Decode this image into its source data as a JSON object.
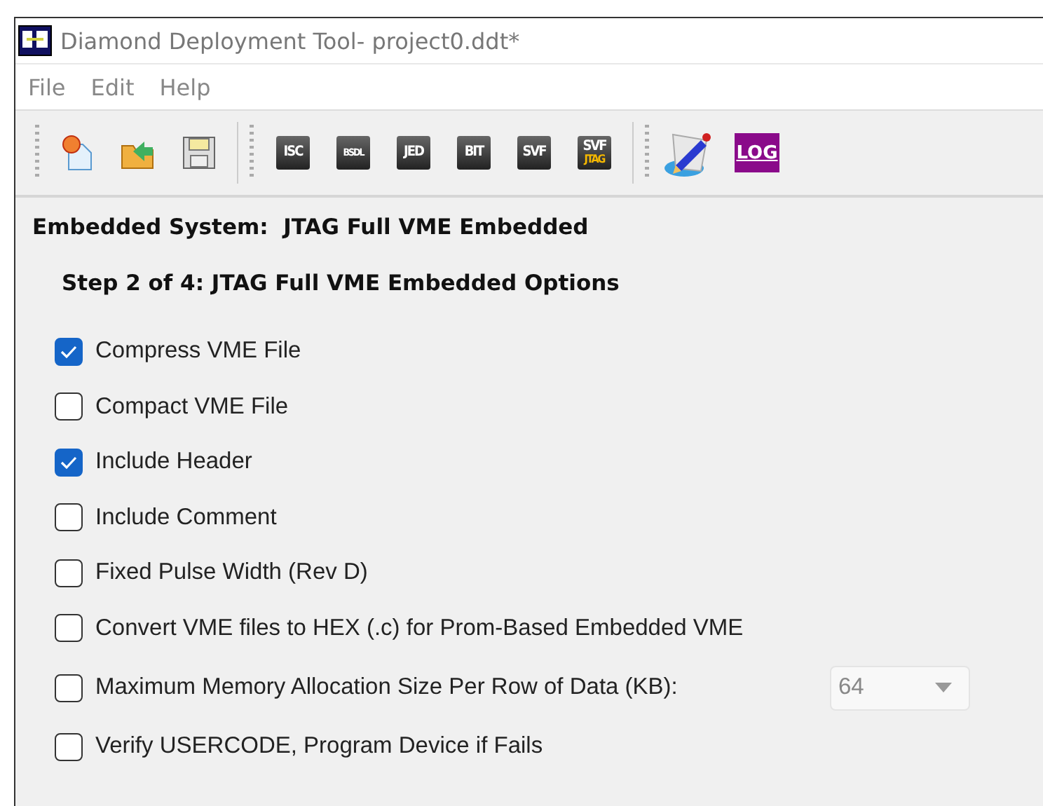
{
  "window": {
    "title": "Diamond Deployment Tool- project0.ddt*"
  },
  "menu": [
    "File",
    "Edit",
    "Help"
  ],
  "toolbar": [
    {
      "kind": "new"
    },
    {
      "kind": "open"
    },
    {
      "kind": "save"
    },
    {
      "kind": "sep"
    },
    {
      "kind": "chip",
      "label": "ISC"
    },
    {
      "kind": "chip",
      "label": "BSDL"
    },
    {
      "kind": "chip",
      "label": "JED"
    },
    {
      "kind": "chip",
      "label": "BIT"
    },
    {
      "kind": "chip",
      "label": "SVF"
    },
    {
      "kind": "chip",
      "label": "SVF",
      "sub": "JTAG"
    },
    {
      "kind": "sep"
    },
    {
      "kind": "edit"
    },
    {
      "kind": "log",
      "label": "LOG"
    }
  ],
  "heading": "Embedded System:  JTAG Full VME Embedded",
  "step": "Step 2 of 4: JTAG Full VME Embedded Options",
  "options": [
    {
      "label": "Compress VME File",
      "checked": true
    },
    {
      "label": "Compact VME File",
      "checked": false
    },
    {
      "label": "Include Header",
      "checked": true
    },
    {
      "label": "Include Comment",
      "checked": false
    },
    {
      "label": "Fixed Pulse Width (Rev D)",
      "checked": false
    },
    {
      "label": "Convert VME files to HEX (.c) for Prom-Based Embedded VME",
      "checked": false
    },
    {
      "label": "Maximum Memory Allocation Size Per Row of Data (KB):",
      "checked": false,
      "dropdown": {
        "value": "64",
        "disabled": true
      }
    },
    {
      "label": "Verify USERCODE, Program Device if Fails",
      "checked": false
    }
  ]
}
